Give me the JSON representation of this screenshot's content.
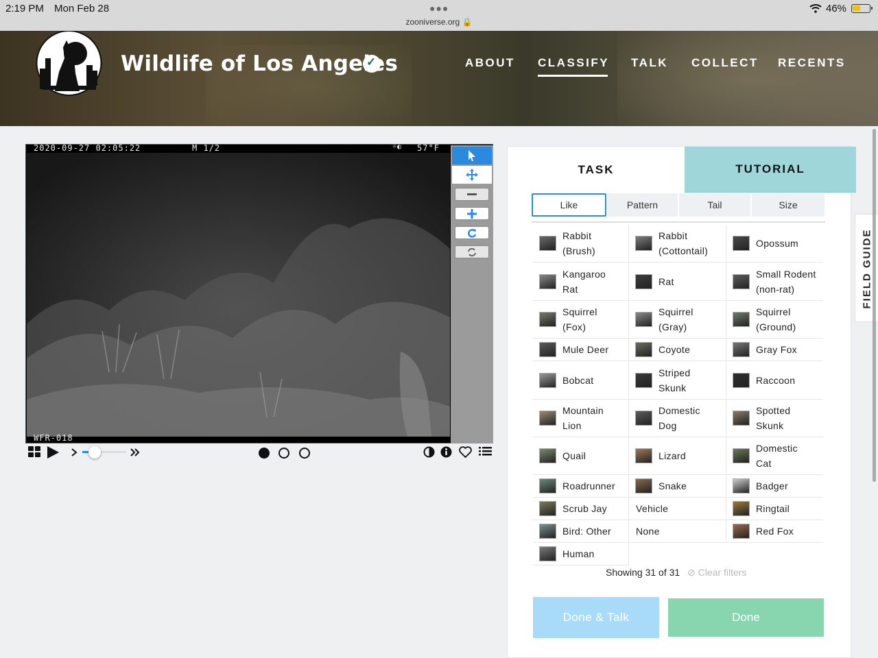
{
  "status_bar": {
    "time": "2:19 PM",
    "date": "Mon Feb 28",
    "url": "zooniverse.org 🔒",
    "battery": "46%"
  },
  "header": {
    "title": "Wildlife of Los Angeles",
    "nav": [
      "ABOUT",
      "CLASSIFY",
      "TALK",
      "COLLECT",
      "RECENTS"
    ],
    "active_nav": "CLASSIFY"
  },
  "camera": {
    "timestamp": "2020-09-27 02:05:22",
    "frame": "M 1/2",
    "temperature": "57°F",
    "camera_id": "WFR-018"
  },
  "panel": {
    "tabs": {
      "task": "TASK",
      "tutorial": "TUTORIAL"
    },
    "filters": [
      "Like",
      "Pattern",
      "Tail",
      "Size"
    ],
    "active_filter": "Like",
    "species": [
      [
        "Rabbit",
        "(Brush)"
      ],
      [
        "Rabbit",
        "(Cottontail)"
      ],
      [
        "Opossum"
      ],
      [
        "Kangaroo",
        "Rat"
      ],
      [
        "Rat"
      ],
      [
        "Small Rodent",
        "(non-rat)"
      ],
      [
        "Squirrel",
        "(Fox)"
      ],
      [
        "Squirrel",
        "(Gray)"
      ],
      [
        "Squirrel",
        "(Ground)"
      ],
      [
        "Mule Deer"
      ],
      [
        "Coyote"
      ],
      [
        "Gray Fox"
      ],
      [
        "Bobcat"
      ],
      [
        "Striped",
        "Skunk"
      ],
      [
        "Raccoon"
      ],
      [
        "Mountain",
        "Lion"
      ],
      [
        "Domestic",
        "Dog"
      ],
      [
        "Spotted",
        "Skunk"
      ],
      [
        "Quail"
      ],
      [
        "Lizard"
      ],
      [
        "Domestic",
        "Cat"
      ],
      [
        "Roadrunner"
      ],
      [
        "Snake"
      ],
      [
        "Badger"
      ],
      [
        "Scrub Jay"
      ],
      [
        "Vehicle"
      ],
      [
        "Ringtail"
      ],
      [
        "Bird: Other"
      ],
      [
        "None"
      ],
      [
        "Red Fox"
      ],
      [
        "Human"
      ]
    ],
    "showing": "Showing 31 of 31",
    "clear_filters": "Clear filters",
    "done_talk": "Done & Talk",
    "done": "Done",
    "field_guide": "FIELD GUIDE"
  },
  "colors": {
    "accent": "#2a8ae0",
    "tutorial_tab": "#9fd6d9",
    "done": "#88d6b0",
    "done_talk": "#a8dbf7"
  }
}
